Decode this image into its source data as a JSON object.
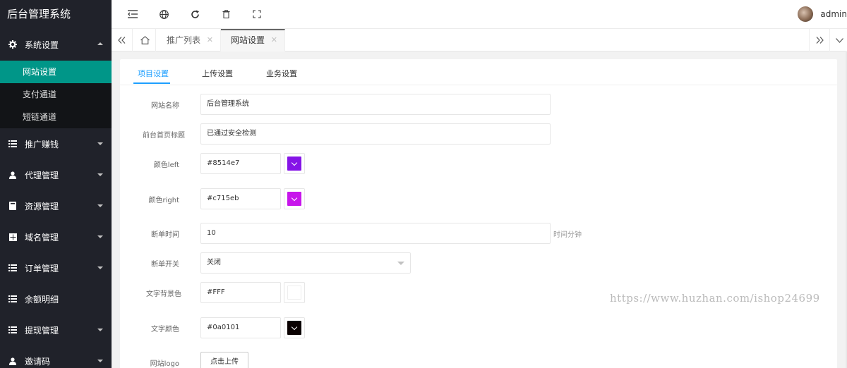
{
  "app": {
    "title": "后台管理系统"
  },
  "sidebar": {
    "groups": [
      {
        "label": "系统设置",
        "icon": "gear-icon",
        "open": true,
        "children": [
          {
            "label": "网站设置",
            "active": true
          },
          {
            "label": "支付通道",
            "active": false
          },
          {
            "label": "短链通道",
            "active": false
          }
        ]
      },
      {
        "label": "推广赚钱",
        "icon": "list-icon"
      },
      {
        "label": "代理管理",
        "icon": "user-group-icon"
      },
      {
        "label": "资源管理",
        "icon": "book-icon"
      },
      {
        "label": "域名管理",
        "icon": "grid-icon"
      },
      {
        "label": "订单管理",
        "icon": "list-icon"
      },
      {
        "label": "余额明细",
        "icon": "list-icon"
      },
      {
        "label": "提现管理",
        "icon": "list-icon"
      },
      {
        "label": "邀请码",
        "icon": "user-icon"
      }
    ]
  },
  "header": {
    "icons": [
      "menu-collapse-icon",
      "globe-icon",
      "refresh-icon",
      "trash-icon",
      "fullscreen-icon"
    ],
    "user": "admin"
  },
  "tabs": {
    "items": [
      {
        "label": "推广列表",
        "active": false
      },
      {
        "label": "网站设置",
        "active": true
      }
    ]
  },
  "content": {
    "tabs": [
      "项目设置",
      "上传设置",
      "业务设置"
    ],
    "form": {
      "site_name": {
        "label": "网站名称",
        "value": "后台管理系统"
      },
      "home_title": {
        "label": "前台首页标题",
        "value": "已通过安全检测"
      },
      "color_left": {
        "label": "颜色left",
        "value": "#8514e7",
        "swatch": "#8514e7"
      },
      "color_right": {
        "label": "颜色right",
        "value": "#c715eb",
        "swatch": "#c715eb"
      },
      "break_time": {
        "label": "断单时间",
        "value": "10",
        "hint": "时间分钟"
      },
      "break_switch": {
        "label": "断单开关",
        "value": "关闭"
      },
      "text_bg": {
        "label": "文字背景色",
        "value": "#FFF",
        "swatch": "#ffffff"
      },
      "text_color": {
        "label": "文字颜色",
        "value": "#0a0101",
        "swatch": "#0a0101"
      },
      "logo": {
        "label": "网站logo",
        "button": "点击上传"
      }
    }
  },
  "watermark": "https://www.huzhan.com/ishop24699"
}
